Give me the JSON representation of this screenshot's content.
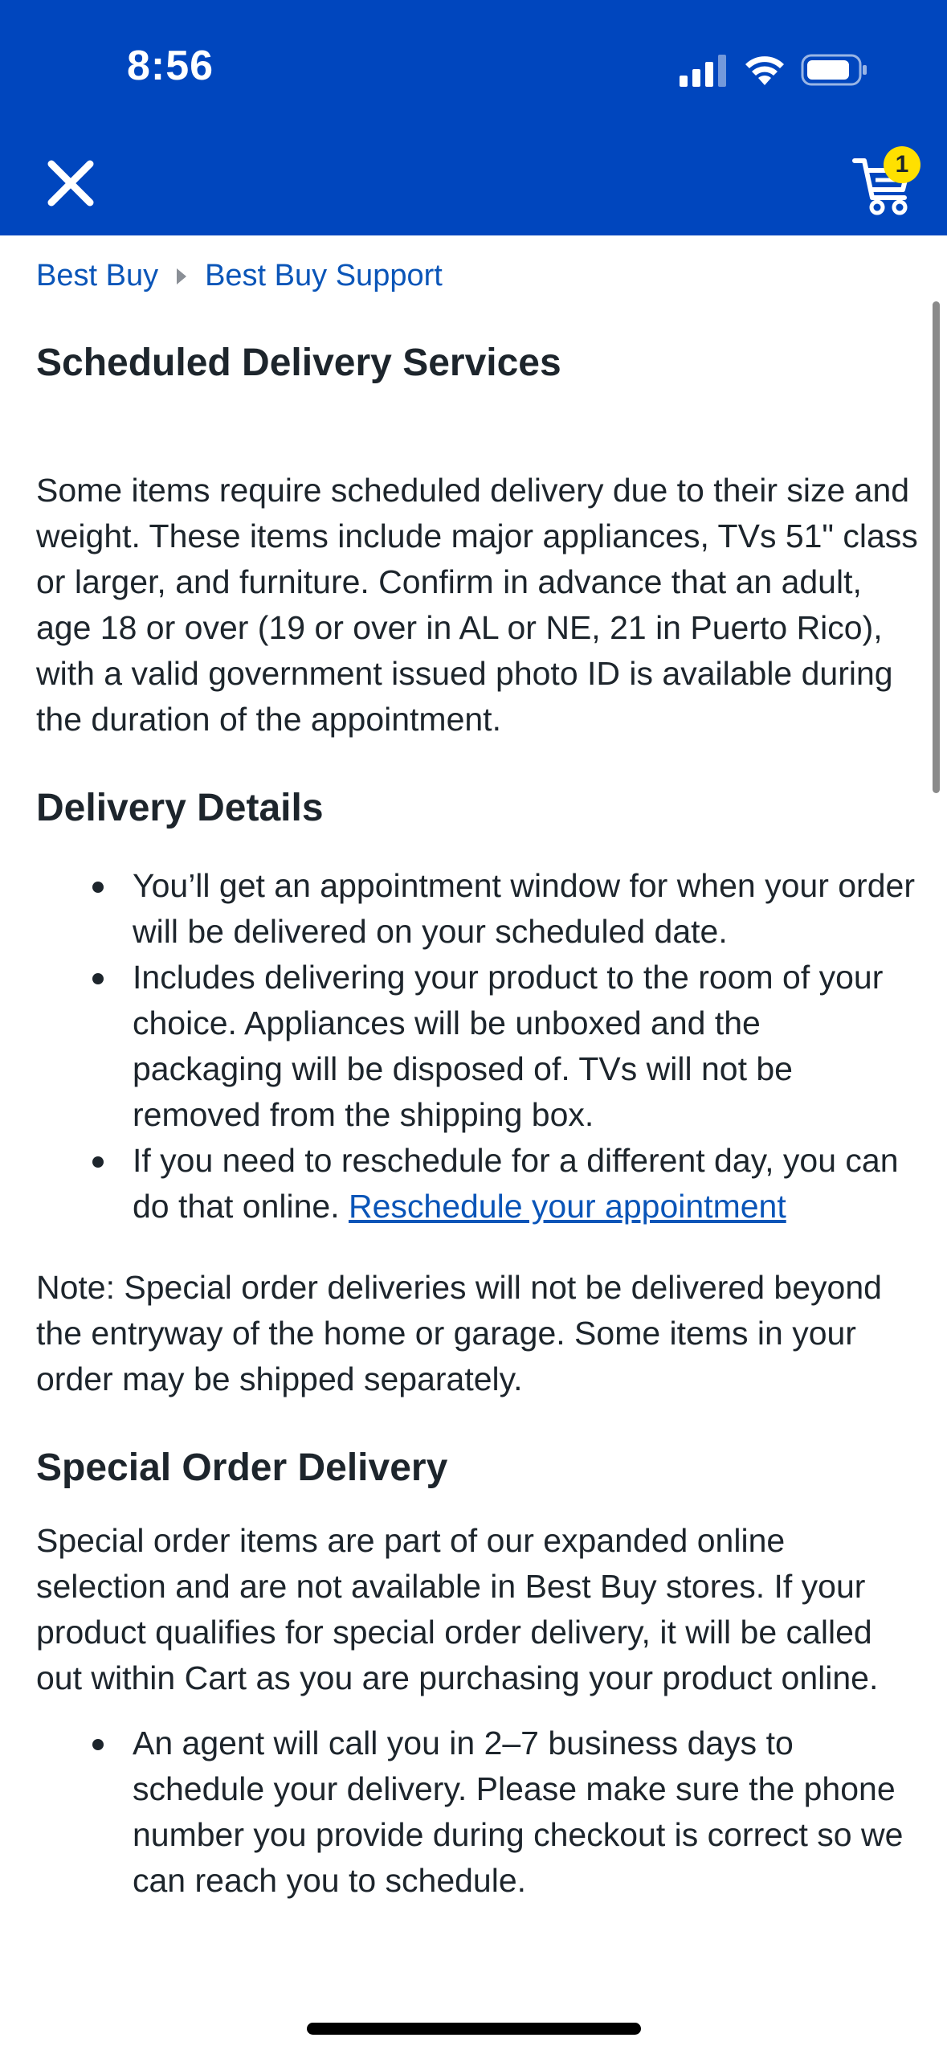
{
  "status_bar": {
    "time": "8:56"
  },
  "header": {
    "close_icon": "close-icon",
    "cart_icon": "cart-icon",
    "cart_count": "1",
    "brand_color": "#0046be",
    "badge_color": "#ffe000"
  },
  "breadcrumb": {
    "items": [
      "Best Buy",
      "Best Buy Support"
    ]
  },
  "page": {
    "title": "Scheduled Delivery Services",
    "intro": "Some items require scheduled delivery due to their size and weight. These items include major appliances, TVs 51\" class or larger, and furniture. Confirm in advance that an adult, age 18 or over (19 or over in AL or NE, 21 in Puerto Rico), with a valid government issued photo ID is available during the duration of the appointment.",
    "delivery_details": {
      "heading": "Delivery Details",
      "bullets": [
        "You’ll get an appointment window for when your order will be delivered on your scheduled date.",
        "Includes delivering your product to the room of your choice. Appliances will be unboxed and the packaging will be disposed of. TVs will not be removed from the shipping box.",
        "If you need to reschedule for a different day, you can do that online. "
      ],
      "reschedule_link": "Reschedule your appointment"
    },
    "note": "Note: Special order deliveries will not be delivered beyond the entryway of the home or garage. Some items in your order may be shipped separately.",
    "special_order": {
      "heading": "Special Order Delivery",
      "text": "Special order items are part of our expanded online selection and are not available in Best Buy stores. If your product qualifies for special order delivery, it will be called out within Cart as you are purchasing your product online.",
      "bullets": [
        "An agent will call you in 2–7 business days to schedule your delivery. Please make sure the phone number you provide during checkout is correct so we can reach you to schedule."
      ]
    }
  }
}
